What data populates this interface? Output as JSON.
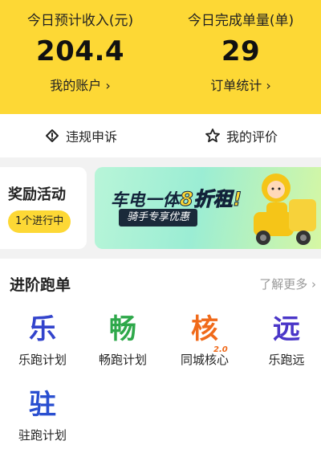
{
  "stats": {
    "income": {
      "label": "今日预计收入(元)",
      "value": "204.4",
      "link": "我的账户 ›"
    },
    "orders": {
      "label": "今日完成单量(单)",
      "value": "29",
      "link": "订单统计 ›"
    }
  },
  "actions": [
    {
      "label": "违规申诉",
      "icon": "appeal-icon"
    },
    {
      "label": "我的评价",
      "icon": "star-icon"
    }
  ],
  "rewards": {
    "title": "奖励活动",
    "badge": "1个进行中"
  },
  "banner": {
    "headline_prefix": "车电一体",
    "headline_accent": "8折租!",
    "subtitle": "骑手专享优惠",
    "image": "rider-scooter-illustration"
  },
  "advanced": {
    "title": "进阶跑单",
    "more": "了解更多 ›",
    "features": [
      {
        "glyph": "乐",
        "name": "乐跑计划",
        "color": "#3344cc"
      },
      {
        "glyph": "畅",
        "name": "畅跑计划",
        "color": "#2ea84a"
      },
      {
        "glyph": "核",
        "badge": "2.0",
        "name": "同城核心",
        "color": "#f06a1a"
      },
      {
        "glyph": "远",
        "name": "乐跑远",
        "color": "#4a36c8"
      },
      {
        "glyph": "驻",
        "name": "驻跑计划",
        "color": "#2a4fd0"
      }
    ]
  },
  "colors": {
    "header_bg": "#fdd835",
    "page_bg": "#f2f2f2"
  }
}
